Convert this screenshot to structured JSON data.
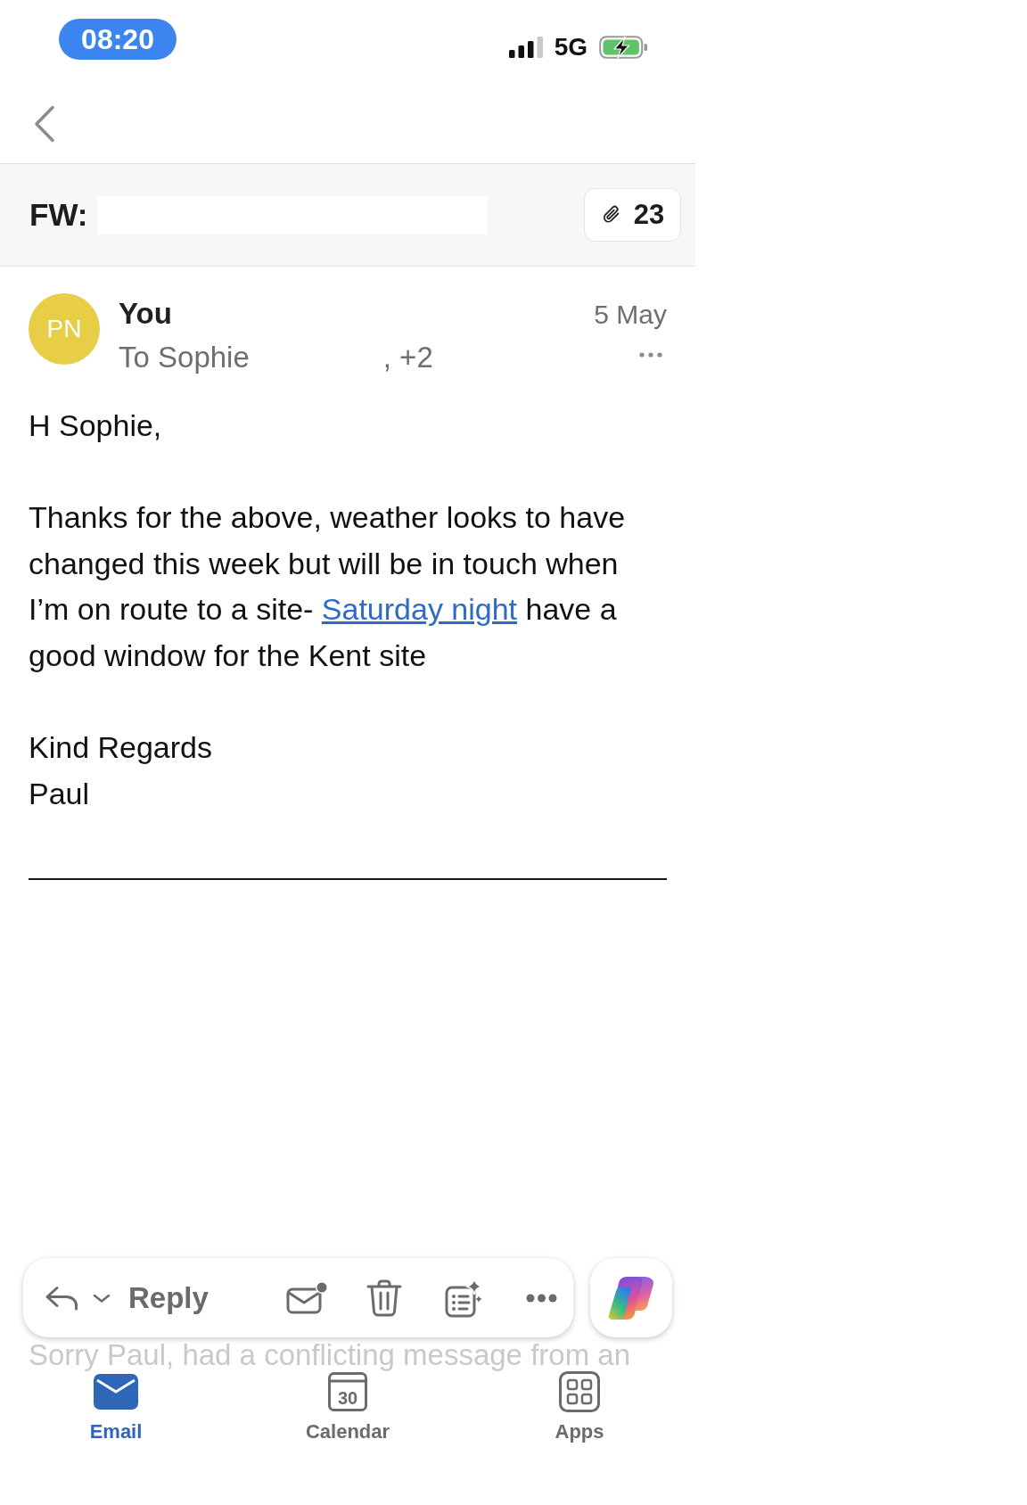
{
  "status_bar": {
    "time": "08:20",
    "network": "5G"
  },
  "subject": {
    "prefix": "FW:",
    "attachment_count": "23"
  },
  "message": {
    "avatar_initials": "PN",
    "sender": "You",
    "recipients": "To Sophie",
    "recipients_more": ", +2",
    "date": "5 May"
  },
  "body": [
    {
      "segments": [
        {
          "text": "H Sophie,"
        }
      ]
    },
    {
      "segments": [
        {
          "text": "Thanks for the above, weather looks to have changed this week but will be in touch when I’m on route to a site- "
        },
        {
          "text": "Saturday night",
          "kind": "link"
        },
        {
          "text": " have a good window for the Kent site"
        }
      ]
    }
  ],
  "signature": [
    "Kind Regards",
    "Paul"
  ],
  "toolbar": {
    "reply_label": "Reply"
  },
  "next_message_preview": "Sorry Paul, had a conflicting message from an",
  "tabs": [
    {
      "kind": "email",
      "label": "Email",
      "selected": true
    },
    {
      "kind": "calendar",
      "label": "Calendar",
      "icon_text": "30",
      "selected": false
    },
    {
      "kind": "apps",
      "label": "Apps",
      "selected": false
    }
  ]
}
